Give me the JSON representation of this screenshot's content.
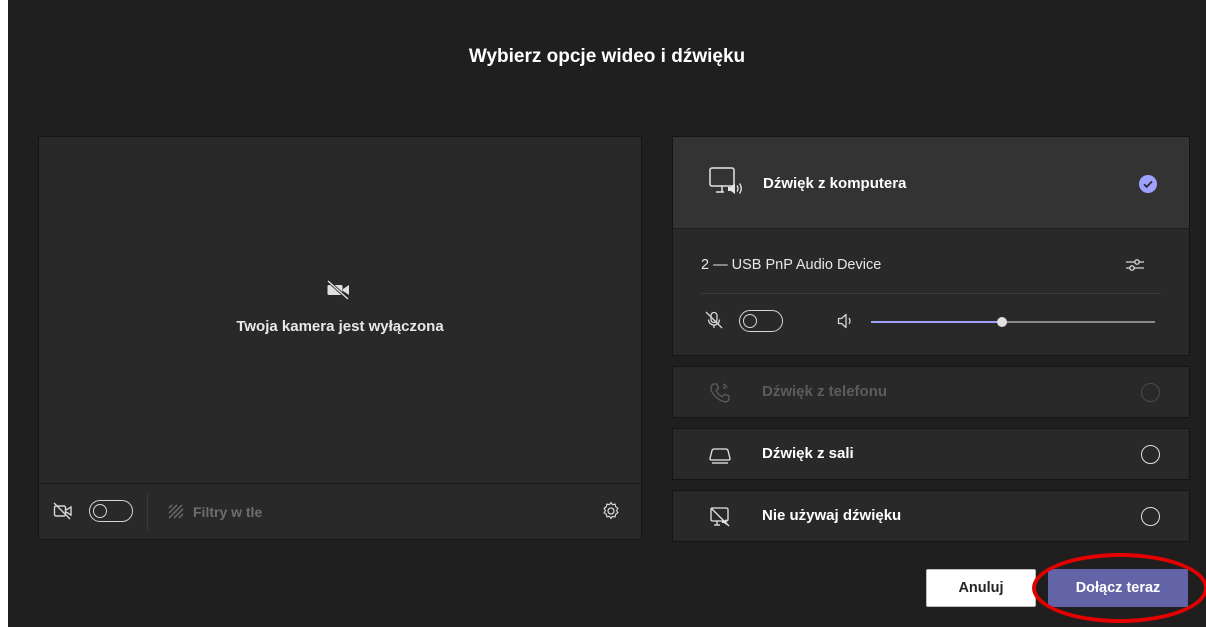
{
  "dialog": {
    "title": "Wybierz opcje wideo i dźwięku"
  },
  "video": {
    "camera_off_text": "Twoja kamera jest wyłączona",
    "camera_toggle_state": "off",
    "filters_label": "Filtry w tle"
  },
  "audio": {
    "options": [
      {
        "label": "Dźwięk z komputera",
        "selected": true,
        "enabled": true
      },
      {
        "label": "Dźwięk z telefonu",
        "selected": false,
        "enabled": false
      },
      {
        "label": "Dźwięk z sali",
        "selected": false,
        "enabled": true
      },
      {
        "label": "Nie używaj dźwięku",
        "selected": false,
        "enabled": true
      }
    ],
    "device_name": "2 — USB PnP Audio Device",
    "mic_toggle_state": "off",
    "volume_fraction": 0.46
  },
  "buttons": {
    "cancel_label": "Anuluj",
    "join_label": "Dołącz teraz"
  },
  "colors": {
    "accent": "#6264a7",
    "check": "#9ea2ff",
    "highlight": "#e30000"
  },
  "icons": [
    "camera-off-icon",
    "gear-icon",
    "background-filters-icon",
    "computer-audio-icon",
    "checkmark-icon",
    "device-settings-icon",
    "mic-off-icon",
    "speaker-icon",
    "phone-audio-icon",
    "room-audio-icon",
    "no-audio-icon"
  ]
}
